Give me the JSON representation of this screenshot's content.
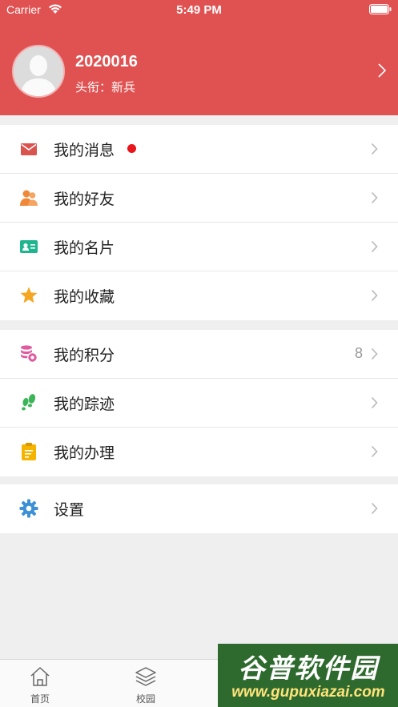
{
  "status_bar": {
    "carrier": "Carrier",
    "time": "5:49 PM"
  },
  "profile": {
    "username": "2020016",
    "title": "头衔：新兵"
  },
  "groups": [
    {
      "items": [
        {
          "label": "我的消息",
          "icon": "envelope-icon",
          "has_dot": true
        },
        {
          "label": "我的好友",
          "icon": "friends-icon"
        },
        {
          "label": "我的名片",
          "icon": "id-card-icon"
        },
        {
          "label": "我的收藏",
          "icon": "star-icon"
        }
      ]
    },
    {
      "items": [
        {
          "label": "我的积分",
          "icon": "coins-icon",
          "value": "8"
        },
        {
          "label": "我的踪迹",
          "icon": "footprints-icon"
        },
        {
          "label": "我的办理",
          "icon": "clipboard-icon"
        }
      ]
    },
    {
      "items": [
        {
          "label": "设置",
          "icon": "gear-icon"
        }
      ]
    }
  ],
  "tabbar": {
    "tabs": [
      {
        "label": "首页",
        "icon": "home-icon"
      },
      {
        "label": "校园",
        "icon": "layers-icon"
      }
    ]
  },
  "watermark": {
    "title": "谷普软件园",
    "url": "www.gupuxiazai.com"
  },
  "colors": {
    "header_bg": "#e05252",
    "envelope": "#d9534f",
    "friends": "#f0883a",
    "id_card": "#1fb58f",
    "star": "#f5a623",
    "coins": "#e05a9e",
    "footprints": "#3cb55a",
    "clipboard": "#f5b400",
    "gear": "#3d8fd6",
    "dot": "#e8151b"
  }
}
